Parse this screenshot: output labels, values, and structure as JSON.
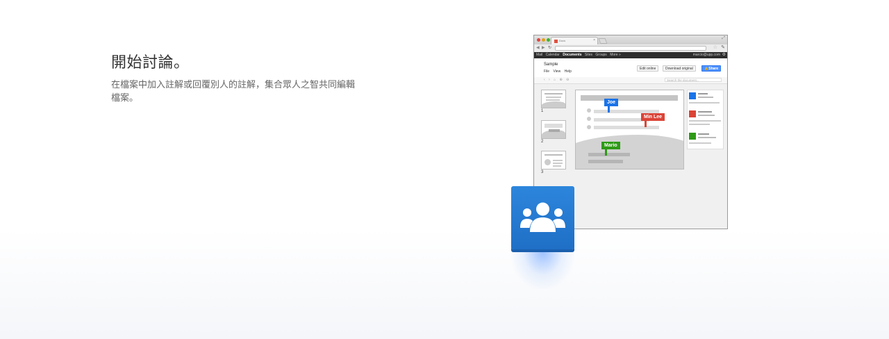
{
  "hero": {
    "title": "開始討論。",
    "description": "在檔案中加入註解或回覆別人的註解，集合眾人之智共同編輯檔案。"
  },
  "browser": {
    "tab_title": "Docs",
    "google_bar": {
      "nav_items": [
        "Mail",
        "Calendar",
        "Documents",
        "Sites",
        "Groups",
        "More »"
      ],
      "active_item": "Documents",
      "account": "marcio@upp.com"
    },
    "document": {
      "title": "Sample",
      "menu": [
        "File",
        "View",
        "Help"
      ],
      "buttons": {
        "edit_online": "Edit online",
        "download_original": "Download original",
        "share": "Share"
      },
      "search_placeholder": "Search the document..."
    },
    "thumbnails": [
      "1",
      "2",
      "3"
    ],
    "collaborators": [
      {
        "name": "Joe",
        "color": "#1a73e8"
      },
      {
        "name": "Min Lee",
        "color": "#db4437"
      },
      {
        "name": "Mario",
        "color": "#2e9a16"
      }
    ]
  },
  "app_icon": {
    "name": "people-group-icon",
    "color": "#2a7fd8"
  }
}
